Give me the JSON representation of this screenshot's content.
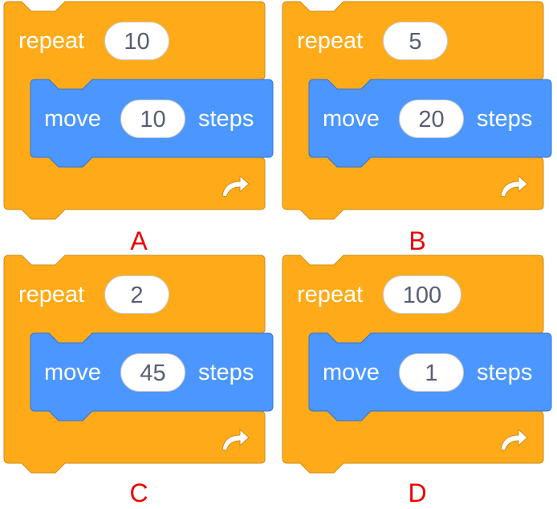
{
  "colors": {
    "control_orange": "#FFAB19",
    "motion_blue": "#4C97FF",
    "label_red": "#EE0000",
    "field_text": "#575E75"
  },
  "options": [
    {
      "letter": "A",
      "repeat_keyword": "repeat",
      "repeat_count": "10",
      "move_keyword": "move",
      "steps_value": "10",
      "steps_keyword": "steps",
      "loop_icon": "loop-arrow-icon"
    },
    {
      "letter": "B",
      "repeat_keyword": "repeat",
      "repeat_count": "5",
      "move_keyword": "move",
      "steps_value": "20",
      "steps_keyword": "steps",
      "loop_icon": "loop-arrow-icon"
    },
    {
      "letter": "C",
      "repeat_keyword": "repeat",
      "repeat_count": "2",
      "move_keyword": "move",
      "steps_value": "45",
      "steps_keyword": "steps",
      "loop_icon": "loop-arrow-icon"
    },
    {
      "letter": "D",
      "repeat_keyword": "repeat",
      "repeat_count": "100",
      "move_keyword": "move",
      "steps_value": "1",
      "steps_keyword": "steps",
      "loop_icon": "loop-arrow-icon"
    }
  ]
}
